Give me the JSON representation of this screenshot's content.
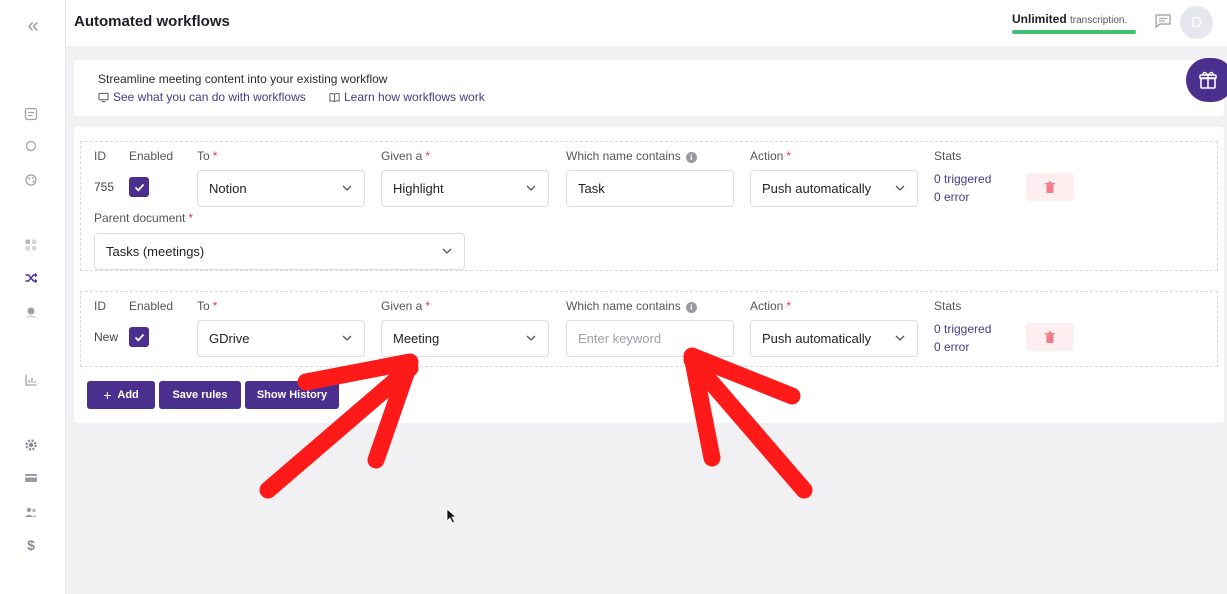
{
  "header": {
    "title": "Automated workflows",
    "plan_strong": "Unlimited",
    "plan_sub": "transcription.",
    "avatar_initial": "D"
  },
  "info": {
    "text": "Streamline meeting content into your existing workflow",
    "link1": "See what you can do with workflows",
    "link2": "Learn how workflows work"
  },
  "labels": {
    "id": "ID",
    "enabled": "Enabled",
    "to": "To",
    "given": "Given a",
    "contains": "Which name contains",
    "action": "Action",
    "stats": "Stats",
    "parent": "Parent document",
    "required_mark": "*"
  },
  "rules": [
    {
      "id": "755",
      "enabled": true,
      "to": "Notion",
      "given": "Highlight",
      "contains_value": "Task",
      "contains_placeholder": "",
      "action": "Push automatically",
      "triggered": "0 triggered",
      "errors": "0 error",
      "parent_document": "Tasks (meetings)"
    },
    {
      "id": "New",
      "enabled": true,
      "to": "GDrive",
      "given": "Meeting",
      "contains_value": "",
      "contains_placeholder": "Enter keyword",
      "action": "Push automatically",
      "triggered": "0 triggered",
      "errors": "0 error"
    }
  ],
  "buttons": {
    "add": "Add",
    "save": "Save rules",
    "history": "Show History"
  },
  "colors": {
    "accent": "#4a2f8f",
    "progress": "#3cc36f",
    "delete_bg": "#fdeef0",
    "annotation": "#ff1a1a"
  },
  "icons": {
    "sidebar": [
      "collapse-icon",
      "notes-icon",
      "search-icon",
      "palette-icon",
      "apps-icon",
      "shuffle-icon",
      "user-pin-icon",
      "chart-icon",
      "gear-icon",
      "card-icon",
      "team-icon",
      "dollar-icon"
    ]
  }
}
